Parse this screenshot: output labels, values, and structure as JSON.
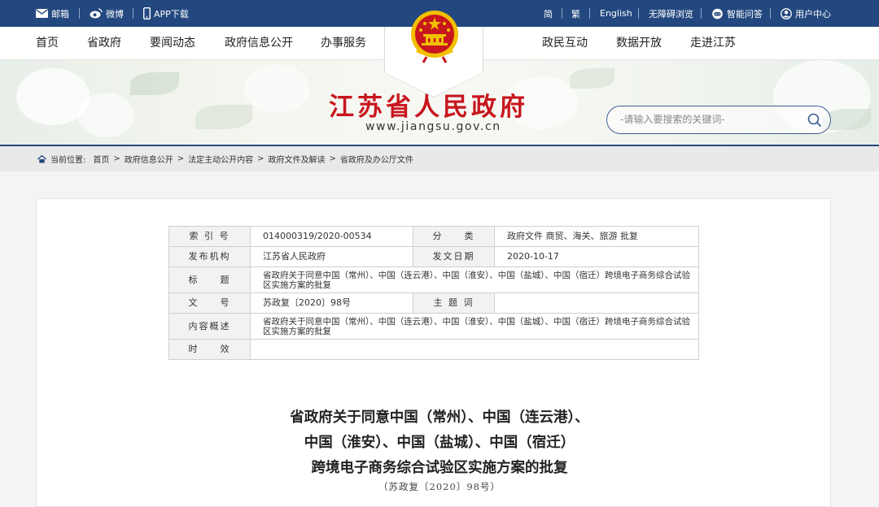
{
  "topbar": {
    "mail_label": "邮箱",
    "weibo_label": "微博",
    "app_label": "APP下载",
    "simplified_label": "简",
    "traditional_label": "繁",
    "english_label": "English",
    "accessibility_label": "无障碍浏览",
    "qa_label": "智能问答",
    "user_center_label": "用户中心"
  },
  "nav": {
    "left": [
      "首页",
      "省政府",
      "要闻动态",
      "政府信息公开",
      "办事服务"
    ],
    "right": [
      "政民互动",
      "数据开放",
      "走进江苏"
    ]
  },
  "banner": {
    "site_name": "江苏省人民政府",
    "site_url": "www.jiangsu.gov.cn",
    "search_placeholder": "-请输入要搜索的关键词-"
  },
  "breadcrumb": {
    "label": "当前位置:",
    "items": [
      "首页",
      "政府信息公开",
      "法定主动公开内容",
      "政府文件及解读",
      "省政府及办公厅文件"
    ]
  },
  "meta": {
    "index_key": "索 引 号",
    "index_value": "014000319/2020-00534",
    "category_key": "分　　类",
    "category_value": "政府文件 商贸、海关、旅游 批复",
    "issuer_key": "发布机构",
    "issuer_value": "江苏省人民政府",
    "date_key": "发文日期",
    "date_value": "2020-10-17",
    "title_key": "标　　题",
    "title_value": "省政府关于同意中国（常州）、中国（连云港）、中国（淮安）、中国（盐城）、中国（宿迁）跨境电子商务综合试验区实施方案的批复",
    "docno_key": "文　　号",
    "docno_value": "苏政复〔2020〕98号",
    "subject_key": "主 题 词",
    "subject_value": "",
    "summary_key": "内容概述",
    "summary_value": "省政府关于同意中国（常州）、中国（连云港）、中国（淮安）、中国（盐城）、中国（宿迁）跨境电子商务综合试验区实施方案的批复",
    "validity_key": "时　　效",
    "validity_value": ""
  },
  "document": {
    "title_line1": "省政府关于同意中国（常州）、中国（连云港）、",
    "title_line2": "中国（淮安）、中国（盐城）、中国（宿迁）",
    "title_line3": "跨境电子商务综合试验区实施方案的批复",
    "doc_number": "（苏政复〔2020〕98号）"
  },
  "colors": {
    "topbar_bg": "#23487f",
    "site_name": "#c8161e",
    "emblem_red": "#c8161e",
    "emblem_gold": "#f2c000"
  }
}
